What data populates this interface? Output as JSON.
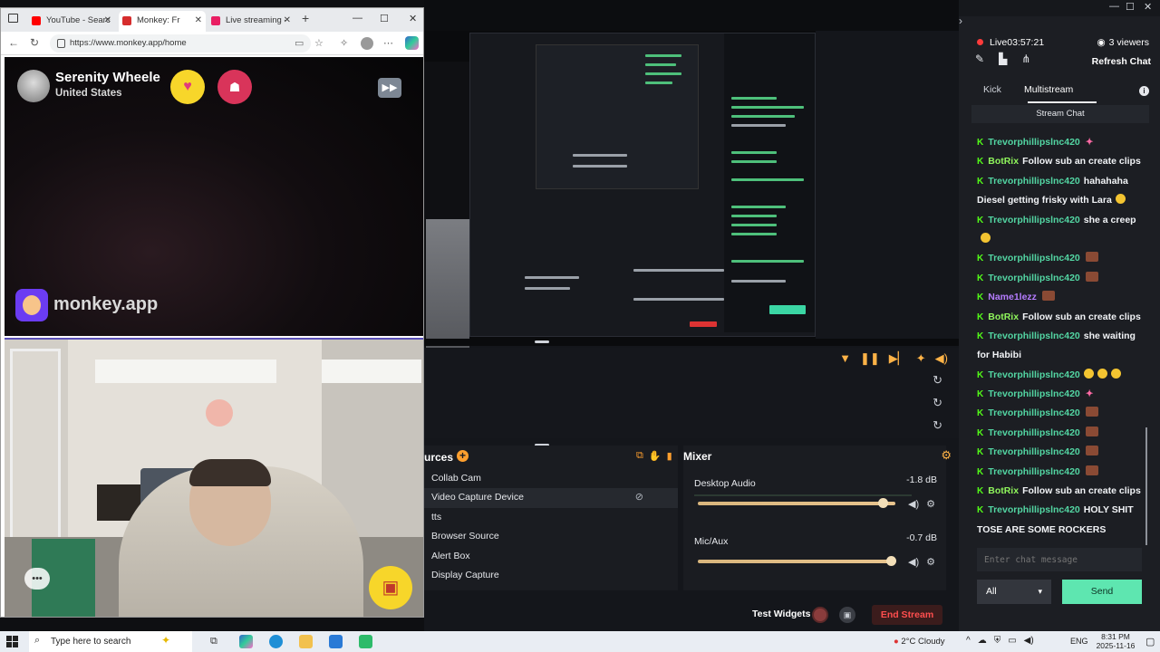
{
  "browser": {
    "tabs": [
      {
        "label": "YouTube - Searc",
        "color": "#ff0000"
      },
      {
        "label": "Monkey: Fr",
        "color": "#d62d2d"
      },
      {
        "label": "Live streaming -",
        "color": "#e91e63"
      }
    ],
    "url": "https://www.monkey.app/home"
  },
  "monkey": {
    "stranger_name": "Serenity Wheele",
    "stranger_country": "United States",
    "brand": "monkey.app",
    "icons": {
      "heart": "heart-badge-icon",
      "police": "police-badge-icon",
      "skip": "skip-forward-icon",
      "gift": "gift-icon",
      "chat": "chat-bubble-icon"
    }
  },
  "obs": {
    "sources_title": "urces",
    "sources": [
      {
        "label": "Collab Cam",
        "active": false
      },
      {
        "label": "Video Capture Device",
        "active": true
      },
      {
        "label": "tts",
        "active": false
      },
      {
        "label": "Browser Source",
        "active": false
      },
      {
        "label": "Alert Box",
        "active": false
      },
      {
        "label": "Display Capture",
        "active": false
      }
    ],
    "mixer_title": "Mixer",
    "channels": [
      {
        "name": "Desktop Audio",
        "db": "-1.8 dB",
        "level": 0.94
      },
      {
        "name": "Mic/Aux",
        "db": "-0.7 dB",
        "level": 0.98
      }
    ],
    "test_widgets": "Test Widgets",
    "end_stream": "End Stream"
  },
  "chat": {
    "live_label": "Live",
    "live_time": "03:57:21",
    "viewers": "3 viewers",
    "refresh": "Refresh Chat",
    "tabs": [
      "Kick",
      "Multistream"
    ],
    "stream_chat": "Stream Chat",
    "messages": [
      {
        "user": "Trevorphillipslnc420",
        "text": "",
        "emote": "pink",
        "style": "green"
      },
      {
        "user": "BotRix",
        "text": "Follow sub an create clips",
        "emote": "",
        "style": "lime"
      },
      {
        "user": "Trevorphillipslnc420",
        "text": "hahahaha",
        "emote": "",
        "style": "green"
      },
      {
        "user": "",
        "text": "Diesel getting frisky with Lara",
        "emote": "yellow",
        "style": "plain"
      },
      {
        "user": "Trevorphillipslnc420",
        "text": "she a creep",
        "emote": "",
        "style": "green"
      },
      {
        "user": "",
        "text": "",
        "emote": "yellow",
        "style": "plain"
      },
      {
        "user": "Trevorphillipslnc420",
        "text": "",
        "emote": "box",
        "style": "green"
      },
      {
        "user": "Trevorphillipslnc420",
        "text": "",
        "emote": "box",
        "style": "green"
      },
      {
        "user": "Name1lezz",
        "text": "",
        "emote": "box",
        "style": "purple"
      },
      {
        "user": "BotRix",
        "text": "Follow sub an create clips",
        "emote": "",
        "style": "lime"
      },
      {
        "user": "Trevorphillipslnc420",
        "text": "she waiting",
        "emote": "",
        "style": "green"
      },
      {
        "user": "",
        "text": "for Habibi",
        "emote": "",
        "style": "plain"
      },
      {
        "user": "Trevorphillipslnc420",
        "text": "",
        "emote": "yellow3",
        "style": "green"
      },
      {
        "user": "Trevorphillipslnc420",
        "text": "",
        "emote": "pink",
        "style": "green"
      },
      {
        "user": "Trevorphillipslnc420",
        "text": "",
        "emote": "box",
        "style": "green"
      },
      {
        "user": "Trevorphillipslnc420",
        "text": "",
        "emote": "box",
        "style": "green"
      },
      {
        "user": "Trevorphillipslnc420",
        "text": "",
        "emote": "box",
        "style": "green"
      },
      {
        "user": "Trevorphillipslnc420",
        "text": "",
        "emote": "box",
        "style": "green"
      },
      {
        "user": "BotRix",
        "text": "Follow sub an create clips",
        "emote": "",
        "style": "lime"
      },
      {
        "user": "Trevorphillipslnc420",
        "text": "HOLY SHIT",
        "emote": "",
        "style": "green"
      },
      {
        "user": "",
        "text": "TOSE ARE SOME ROCKERS",
        "emote": "",
        "style": "plain"
      }
    ],
    "input_placeholder": "Enter chat message",
    "select_value": "All",
    "send": "Send"
  },
  "taskbar": {
    "search_placeholder": "Type here to search",
    "weather": "2°C  Cloudy",
    "lang": "ENG",
    "time": "8:31 PM",
    "date": "2025-11-16"
  }
}
